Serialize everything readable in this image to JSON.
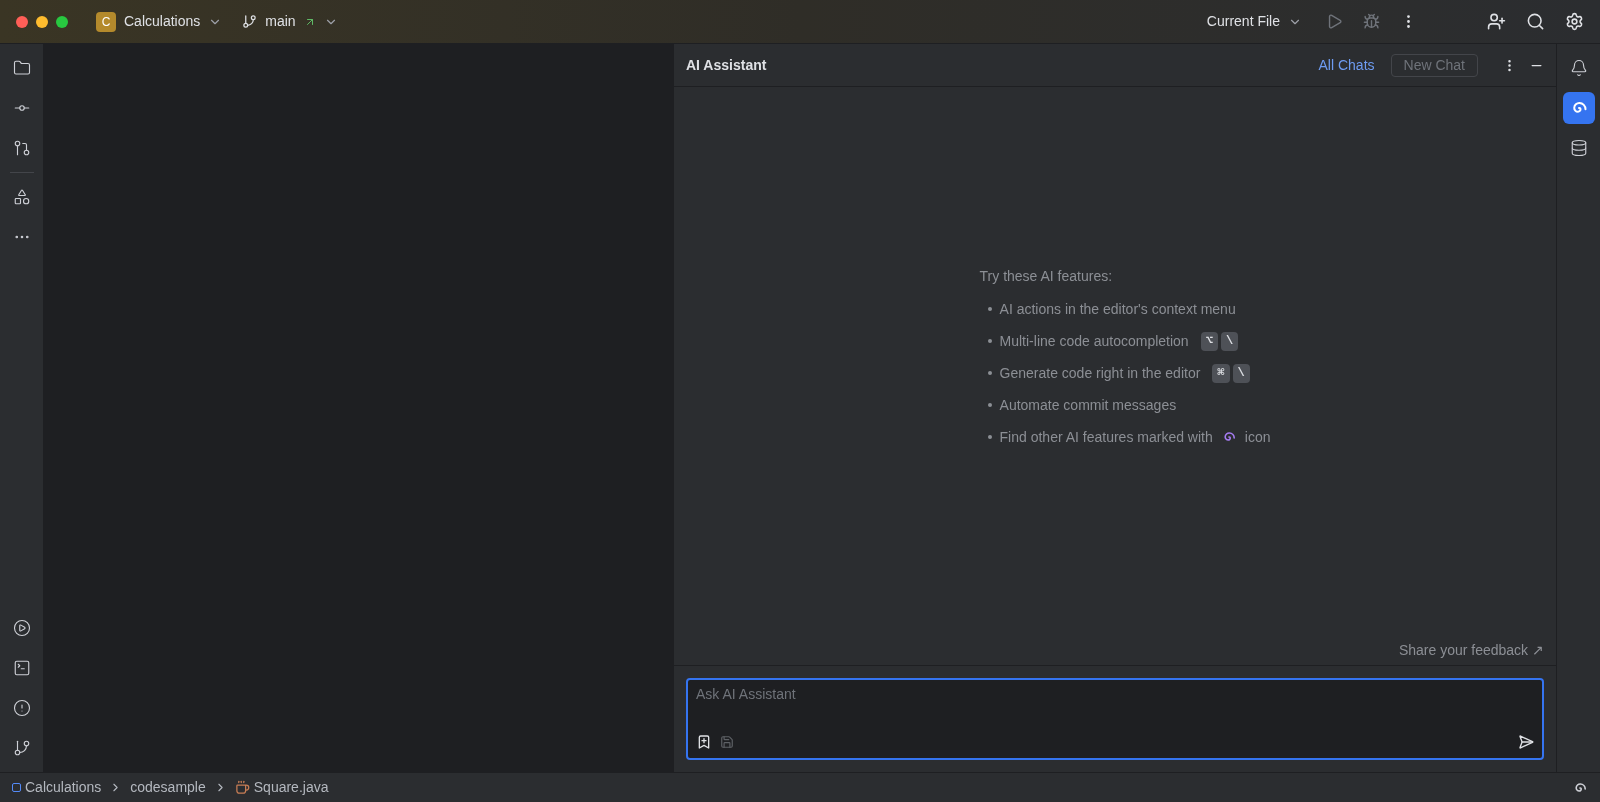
{
  "title_bar": {
    "project_initial": "C",
    "project": "Calculations",
    "branch": "main",
    "run_config": "Current File"
  },
  "right_toolbar": [
    {
      "kind": "notifications",
      "selected": false
    },
    {
      "kind": "ai",
      "selected": true
    },
    {
      "kind": "database",
      "selected": false
    }
  ],
  "ai_panel": {
    "title": "AI Assistant",
    "all_chats": "All Chats",
    "new_chat": "New Chat",
    "new_chat_disabled": true,
    "intro": "Try these AI features:",
    "features": [
      {
        "text": "AI actions in the editor's context menu"
      },
      {
        "text": "Multi-line code autocompletion",
        "keys": [
          "⌥",
          "\\"
        ]
      },
      {
        "text": "Generate code right in the editor",
        "keys": [
          "⌘",
          "\\"
        ]
      },
      {
        "text": "Automate commit messages"
      },
      {
        "text": "Find other AI features marked with",
        "after_icon": "icon"
      }
    ],
    "feedback": "Share your feedback ↗",
    "input": {
      "placeholder": "Ask AI Assistant"
    }
  },
  "breadcrumbs": [
    {
      "kind": "module",
      "label": "Calculations"
    },
    {
      "kind": "folder",
      "label": "codesample"
    },
    {
      "kind": "java",
      "label": "Square.java"
    }
  ]
}
